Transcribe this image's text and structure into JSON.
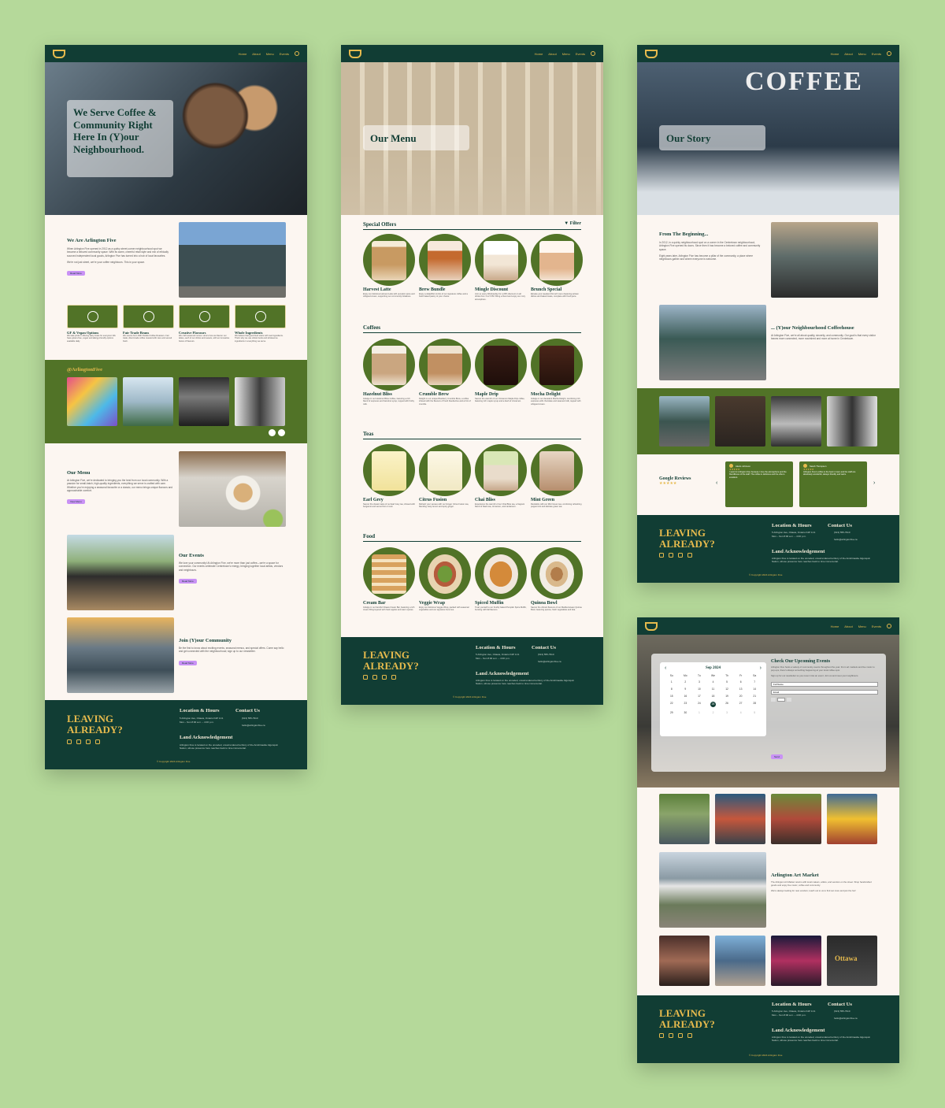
{
  "nav": {
    "links": [
      "Home",
      "About",
      "Menu",
      "Events"
    ]
  },
  "home": {
    "hero_title": "We Serve Coffee & Community Right Here In (Y)our Neighbourhood.",
    "about_title": "We Are Arlington Five",
    "about_text": "When Arlington Five opened in 2012 as a quirky street-corner neighbourhood spot we became a beloved community space. With its warm, cheerful retail style and mix of ethically sourced independent local goods, Arlington Five has turned into a hub of local favourites.",
    "about_text2": "We're not just street, we're your coffee neighbours. This is your space.",
    "read_more": "Read More",
    "values": [
      {
        "name": "GF & Vegan Options",
        "text": "We take pride in offering tasty treats for everyone! We have gluten-free, vegan and allergy-friendly options available daily."
      },
      {
        "name": "Fair Trade Beans",
        "text": "We source from 49th Parallel Coffee Roasters. Fair trade, direct-trade coffee roasted with care and served fresh."
      },
      {
        "name": "Creative Flavours",
        "text": "We craft seasonal menus. Here's how we flavour our lattes, each of our drinks and sweets, with an innovative fusion of flavours."
      },
      {
        "name": "Whole Ingredients",
        "text": "We believe that good food starts with real ingredients. That's why we use whole foods and wholesome ingredients in everything we serve."
      }
    ],
    "social_handle": "@ArlingtonFive",
    "menu_title": "Our Menu",
    "menu_text": "At Arlington Five, we're dedicated to bringing you the best from our local community. With a passion for small-batch, high-quality ingredients, everything we serve is crafted with care. Whether you're enjoying a seasonal favourite or a classic, our menu brings unique flavours and approachable comfort.",
    "menu_btn": "View Menu",
    "events_title": "Our Events",
    "events_text": "We love your community! At Arlington Five, we're more than just coffee—we're a space for connection. Our events celebrate Centretown's energy, bringing together local artists, vendors and neighbours.",
    "community_title": "Join (Y)our Community",
    "community_text": "Be the first to know about exciting events, seasonal menus, and special offers. Come say hello and get connected with the neighbourhood; sign up to our newsletter."
  },
  "menu": {
    "hero_title": "Our Menu",
    "filter": "Filter",
    "sections": [
      {
        "title": "Special Offers",
        "items": [
          {
            "name": "Harvest Latte",
            "text": "Enjoy our delicious Harvest Latte with pumpkin spice and whipped cream, supporting our community initiatives."
          },
          {
            "name": "Brew Bundle",
            "text": "Enjoy a delightful combo of our signature coffee and a fresh baked pastry of your choice."
          },
          {
            "name": "Mingle Discount",
            "text": "Join us every Wednesday for a 20% discount on all drinks from 3 to 5 PM. Bring a friend and enjoy our cozy atmosphere."
          },
          {
            "name": "Brunch Special",
            "text": "Elevate your weekend brunch menu featuring artisan dishes and baked treats, complete with fresh juice."
          }
        ]
      },
      {
        "title": "Coffees",
        "items": [
          {
            "name": "Hazelnut Bliss",
            "text": "Indulge in our Hazelnut Bliss Coffee, featuring a rich blend of espresso and hazelnut syrup, topped with frothy milk."
          },
          {
            "name": "Crumble Brew",
            "text": "Delight in our unique Blueberry Crumble Brew, a coffee infused with the flavours of fresh blueberries and a hint of crumble."
          },
          {
            "name": "Maple Drip",
            "text": "Savour the warmth of our Cinnamon Maple Drip coffee, featuring rich maple syrup and a dash of cinnamon."
          },
          {
            "name": "Mocha Delight",
            "text": "Indulge in our decadent Mocha Delight, combining rich espresso with chocolate and steamed milk, topped with whipped cream."
          }
        ]
      },
      {
        "title": "Teas",
        "items": [
          {
            "name": "Earl Grey",
            "text": "Savour the classic taste of our Earl Grey tea, infused with bergamot and served hot or iced."
          },
          {
            "name": "Citrus Fusion",
            "text": "Refresh your senses with our Ginger Citrus Fusion tea, blending zesty lemon and spicy ginger."
          },
          {
            "name": "Chai Bliss",
            "text": "Experience the warmth of our Chai Bliss tea, a fragrant blend of black tea, cinnamon, and cardamom."
          },
          {
            "name": "Mint Green",
            "text": "Revitalize with our Mint Green tea, combining refreshing peppermint and delicate green tea."
          }
        ]
      },
      {
        "title": "Food",
        "items": [
          {
            "name": "Cream Bar",
            "text": "Indulge in our fanciful Ottawa Cream Bar, featuring a rich cream filling layered with fresh apples and warm spices."
          },
          {
            "name": "Veggie Wrap",
            "text": "Enjoy our delicious Veggie Wrap, packed with seasonal vegetables and our signature hummus."
          },
          {
            "name": "Spiced Muffin",
            "text": "Treat yourself to our freshly baked Pumpkin Spice Muffin, bursting with fall flavours."
          },
          {
            "name": "Quinoa Bowl",
            "text": "Savour the vibrant flavours of our Mediterranean Quinoa Bowl, featuring quinoa, fresh vegetables and feta."
          }
        ]
      }
    ]
  },
  "story": {
    "hero_title": "Our Story",
    "sign": "COFFEE",
    "begin_title": "From The Beginning...",
    "begin_text": "In 2012, in a quirky neighbourhood spot on a corner in the Centretown neighbourhood, Arlington Five opened its doors. Since then it has become a beloved coffee and community space.",
    "begin_text2": "Eight years later, Arlington Five has become a pillar of the community, a place where neighbours gather and where everyone is welcome.",
    "hood_title": "... (Y)our Neighbourhood Coffeehouse",
    "hood_text": "At Arlington Five, we're all about quality, sincerity, and community. Our goal is that every visitor leaves more connected, more nourished and more at home in Centretown.",
    "reviews_title": "Google Reviews",
    "stars": "★★★★★",
    "reviews": [
      {
        "name": "Alexis Johnson",
        "text": "I went for Arlington Five because I love the atmosphere and the friendliness of the staff. The coffee is delicious and the vibe is excellent."
      },
      {
        "name": "Sarah Thompson",
        "text": "Arlington Five's coffee is the best in town and the staff are absolutely wonderful, always friendly and warm."
      }
    ]
  },
  "events": {
    "cal_month": "Sep 2024",
    "days": [
      "Su",
      "Mo",
      "Tu",
      "We",
      "Th",
      "Fr",
      "Sa"
    ],
    "dates": [
      "1",
      "2",
      "3",
      "4",
      "5",
      "6",
      "7",
      "8",
      "9",
      "10",
      "11",
      "12",
      "13",
      "14",
      "15",
      "16",
      "17",
      "18",
      "19",
      "20",
      "21",
      "22",
      "23",
      "24",
      "25",
      "26",
      "27",
      "28",
      "29",
      "30",
      "1",
      "2",
      "3",
      "4",
      "5"
    ],
    "selected": "25",
    "upcoming_title": "Check Our Upcoming Events",
    "upcoming_text": "Arlington Five hosts a variety of community events throughout the year. From art markets and live music to pop-ups, there's always something happening at your local coffee spot.",
    "upcoming_text2": "Sign up for our newsletter so you never miss an event. Join us and meet your neighbours.",
    "field_name": "Full Name",
    "field_email": "Email",
    "submit": "Send",
    "market_title": "Arlington Art Market",
    "market_text": "The Arlington Art Market returns with local makers, artists, and vendors on the street. Shop handcrafted goods and enjoy live music, coffee and community.",
    "market_text2": "We're always looking for new vendors; reach out to us to find out more and join the fun!",
    "venue": "Ottawa"
  },
  "footer": {
    "leaving": "LEAVING ALREADY?",
    "location_title": "Location & Hours",
    "location_text": "5 Arlington Ave, Ottawa, Ontario K2P 1C1",
    "hours": "Mon – Sun 8:00 a.m. – 4:00 p.m.",
    "contact_title": "Contact Us",
    "phone": "(613) 555-7910",
    "email": "hello@arlingtonfive.ca",
    "land_title": "Land Acknowledgement",
    "land_text": "Arlington Five is located on the unceded, unsurrendered territory of the Anishinaabe Algonquin Nation, whose presence here reaches back to time immemorial.",
    "copyright": "© Copyright 2024 Arlington Five"
  },
  "colors": {
    "bg": "#b5d99a",
    "dark": "#113d34",
    "olive": "#517327",
    "gold": "#e6ba4d",
    "cream": "#fcf6f1",
    "lilac": "#c992f5"
  }
}
